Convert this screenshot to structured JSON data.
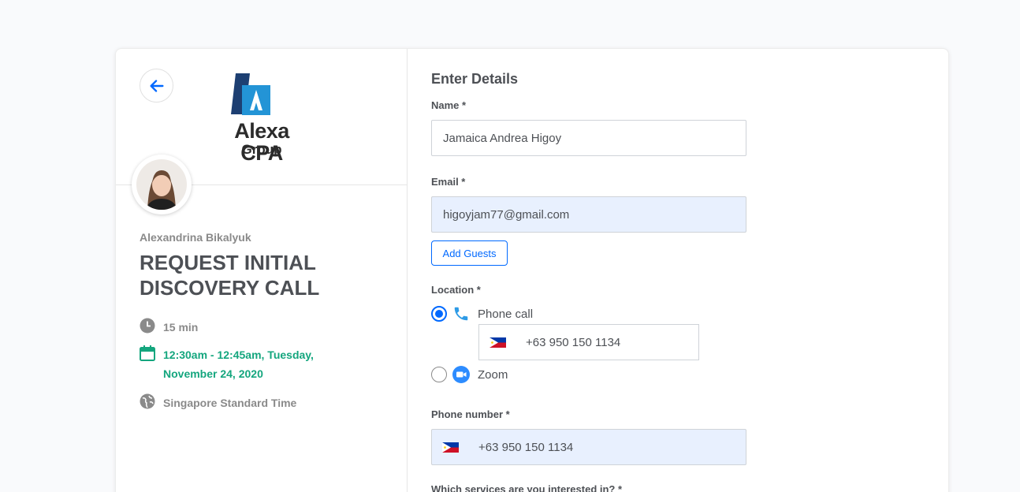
{
  "profile": {
    "organizer": "Alexandrina Bikalyuk",
    "logo_text": "Alexa CPA",
    "logo_subtext": "Group",
    "event_title": "REQUEST INITIAL DISCOVERY CALL",
    "duration": "15 min",
    "datetime": "12:30am - 12:45am, Tuesday, November 24, 2020",
    "timezone": "Singapore Standard Time"
  },
  "form": {
    "heading": "Enter Details",
    "name_label": "Name *",
    "name_value": "Jamaica Andrea Higoy",
    "email_label": "Email *",
    "email_value": "higoyjam77@gmail.com",
    "add_guests": "Add Guests",
    "location_label": "Location *",
    "location_options": [
      {
        "label": "Phone call",
        "selected": true,
        "icon": "phone-icon"
      },
      {
        "label": "Zoom",
        "selected": false,
        "icon": "zoom-icon"
      }
    ],
    "location_phone": "+63 950 150 1134",
    "phone_label": "Phone number *",
    "phone_value": "+63 950 150 1134",
    "services_label": "Which services are you interested in? *"
  },
  "colors": {
    "accent": "#0069ff",
    "green": "#14a67e",
    "autofill": "#e8f0fe"
  }
}
